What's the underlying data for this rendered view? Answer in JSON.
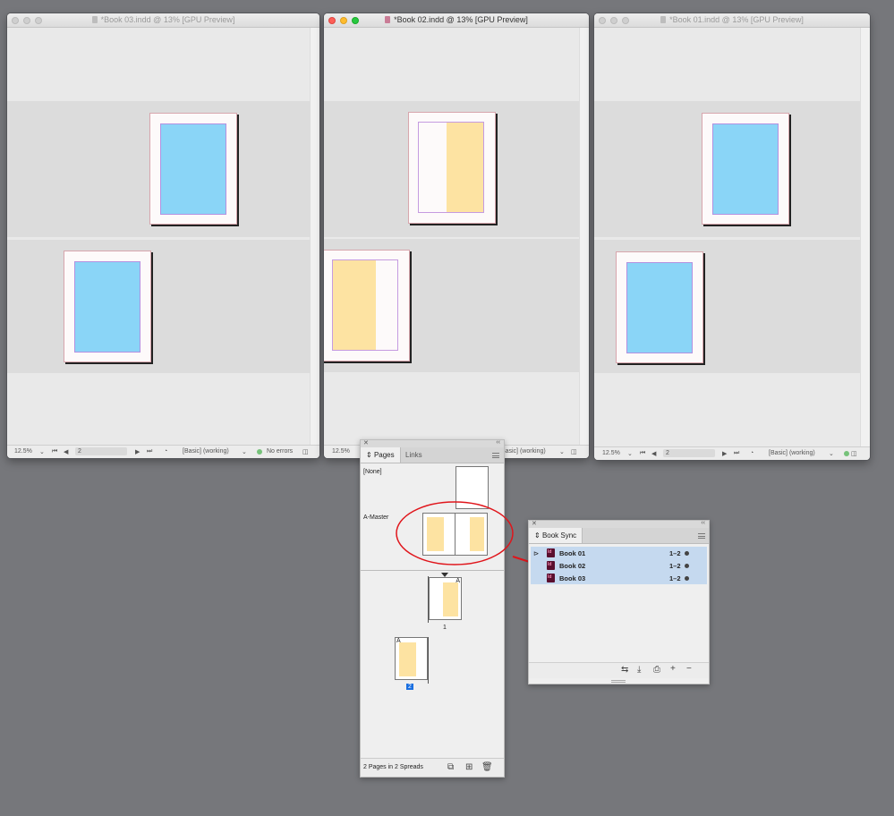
{
  "windows": {
    "book03": {
      "title": "*Book 03.indd @ 13% [GPU Preview]",
      "zoom": "12.5%",
      "page": "2",
      "profile": "[Basic] (working)",
      "preflight": "No errors"
    },
    "book02": {
      "title": "*Book 02.indd @ 13% [GPU Preview]",
      "zoom": "12.5%",
      "profile": "[Basic] (working)"
    },
    "book01": {
      "title": "*Book 01.indd @ 13% [GPU Preview]",
      "zoom": "12.5%",
      "page": "2",
      "profile": "[Basic] (working)"
    }
  },
  "pages_panel": {
    "tabs": [
      "Pages",
      "Links"
    ],
    "masters": [
      "[None]",
      "A-Master"
    ],
    "page_labels": [
      "1",
      "2"
    ],
    "page_prefix": "A",
    "footer": "2 Pages in 2 Spreads"
  },
  "book_sync_panel": {
    "tab": "Book Sync",
    "rows": [
      {
        "name": "Book 01",
        "pages": "1–2"
      },
      {
        "name": "Book 02",
        "pages": "1–2"
      },
      {
        "name": "Book 03",
        "pages": "1–2"
      }
    ]
  },
  "colors": {
    "annotation": "#e0151b",
    "fill_blue": "#8ad5f7",
    "fill_yellow": "#fde3a2",
    "selection": "#c5d9ef"
  }
}
